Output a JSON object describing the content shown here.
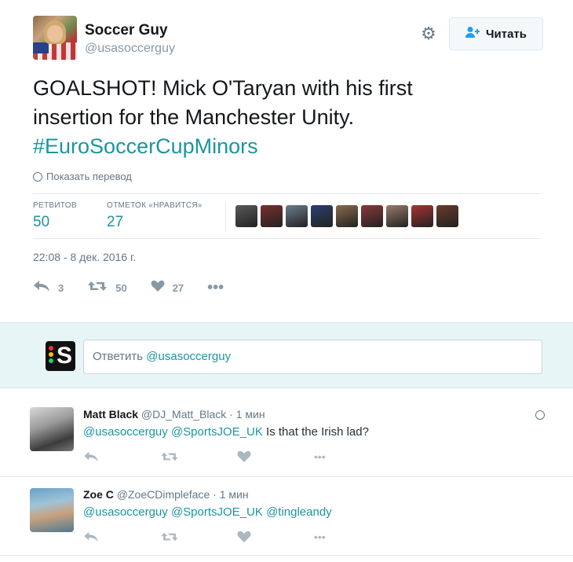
{
  "author": {
    "name": "Soccer Guy",
    "handle": "@usasoccerguy"
  },
  "follow_button": {
    "label": "Читать"
  },
  "tweet": {
    "text_line1": "GOALSHOT! Mick O'Taryan with his first",
    "text_line2": "insertion for the Manchester Unity.",
    "hashtag": "#EuroSoccerCupMinors",
    "translate_label": "Показать перевод"
  },
  "stats": {
    "retweets_label": "РЕТВИТОВ",
    "retweets": "50",
    "likes_label": "ОТМЕТОК «НРАВИТСЯ»",
    "likes": "27",
    "liker_avatar_colors": [
      "#5a5a5a",
      "#7a2f2f",
      "#6b7d8c",
      "#2b3f6e",
      "#8a6a4a",
      "#8a3a3a",
      "#9a7b6a",
      "#a33",
      "#6a3a2a"
    ]
  },
  "timestamp": "22:08 - 8 дек. 2016 г.",
  "actions": {
    "reply_count": "3",
    "retweet_count": "50",
    "like_count": "27"
  },
  "reply_box": {
    "prefix": "Ответить ",
    "mention": "@usasoccerguy"
  },
  "replies": [
    {
      "name": "Matt Black",
      "handle": "@DJ_Matt_Black",
      "time": "· 1 мин",
      "mention1": "@usasoccerguy",
      "mention2": "@SportsJOE_UK",
      "text": " Is that the Irish lad?"
    },
    {
      "name": "Zoe C",
      "handle": "@ZoeCDimpleface",
      "time": "· 1 мин",
      "mention1": "@usasoccerguy",
      "mention2": "@SportsJOE_UK",
      "mention3": "@tingleandy"
    }
  ],
  "colors": {
    "accent": "#1b95a0",
    "reply_bar_bg": "#e8f5f6"
  }
}
